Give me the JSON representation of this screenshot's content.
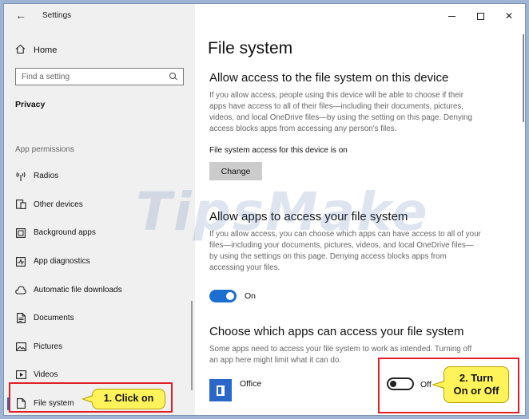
{
  "window": {
    "app_title": "Settings",
    "minimize_glyph": "",
    "close_glyph": "✕"
  },
  "sidebar": {
    "home_label": "Home",
    "search_placeholder": "Find a setting",
    "section_privacy": "Privacy",
    "section_permissions": "App permissions",
    "items": [
      {
        "label": "Radios",
        "icon": "radio-icon"
      },
      {
        "label": "Other devices",
        "icon": "devices-icon"
      },
      {
        "label": "Background apps",
        "icon": "background-apps-icon"
      },
      {
        "label": "App diagnostics",
        "icon": "diagnostics-icon"
      },
      {
        "label": "Automatic file downloads",
        "icon": "cloud-download-icon"
      },
      {
        "label": "Documents",
        "icon": "document-icon"
      },
      {
        "label": "Pictures",
        "icon": "pictures-icon"
      },
      {
        "label": "Videos",
        "icon": "videos-icon"
      },
      {
        "label": "File system",
        "icon": "file-icon",
        "active": true
      }
    ]
  },
  "main": {
    "title": "File system",
    "section1": {
      "heading": "Allow access to the file system on this device",
      "description": "If you allow access, people using this device will be able to choose if their apps have access to all of their files—including their documents, pictures, videos, and local OneDrive files—by using the setting on this page. Denying access blocks apps from accessing any person's files.",
      "status": "File system access for this device is on",
      "button": "Change"
    },
    "section2": {
      "heading": "Allow apps to access your file system",
      "description": "If you allow access, you can choose which apps can have access to all of your files—including your documents, pictures, videos, and local OneDrive files—by using the settings on this page. Denying access blocks apps from accessing your files.",
      "toggle_label": "On",
      "toggle_state": "on"
    },
    "section3": {
      "heading": "Choose which apps can access your file system",
      "description": "Some apps need to access your file system to work as intended. Turning off an app here might limit what it can do.",
      "apps": [
        {
          "name": "Office",
          "toggle_label": "Off",
          "toggle_state": "off"
        }
      ]
    }
  },
  "annotations": {
    "callout1": "1. Click on",
    "callout2_line1": "2. Turn",
    "callout2_line2": "On or Off"
  },
  "watermark": "TipsMake",
  "colors": {
    "accent": "#1c6fd1",
    "highlight_red": "#e01f26",
    "callout_yellow": "#fff35a",
    "sidebar_bg": "#f0f0f0"
  }
}
